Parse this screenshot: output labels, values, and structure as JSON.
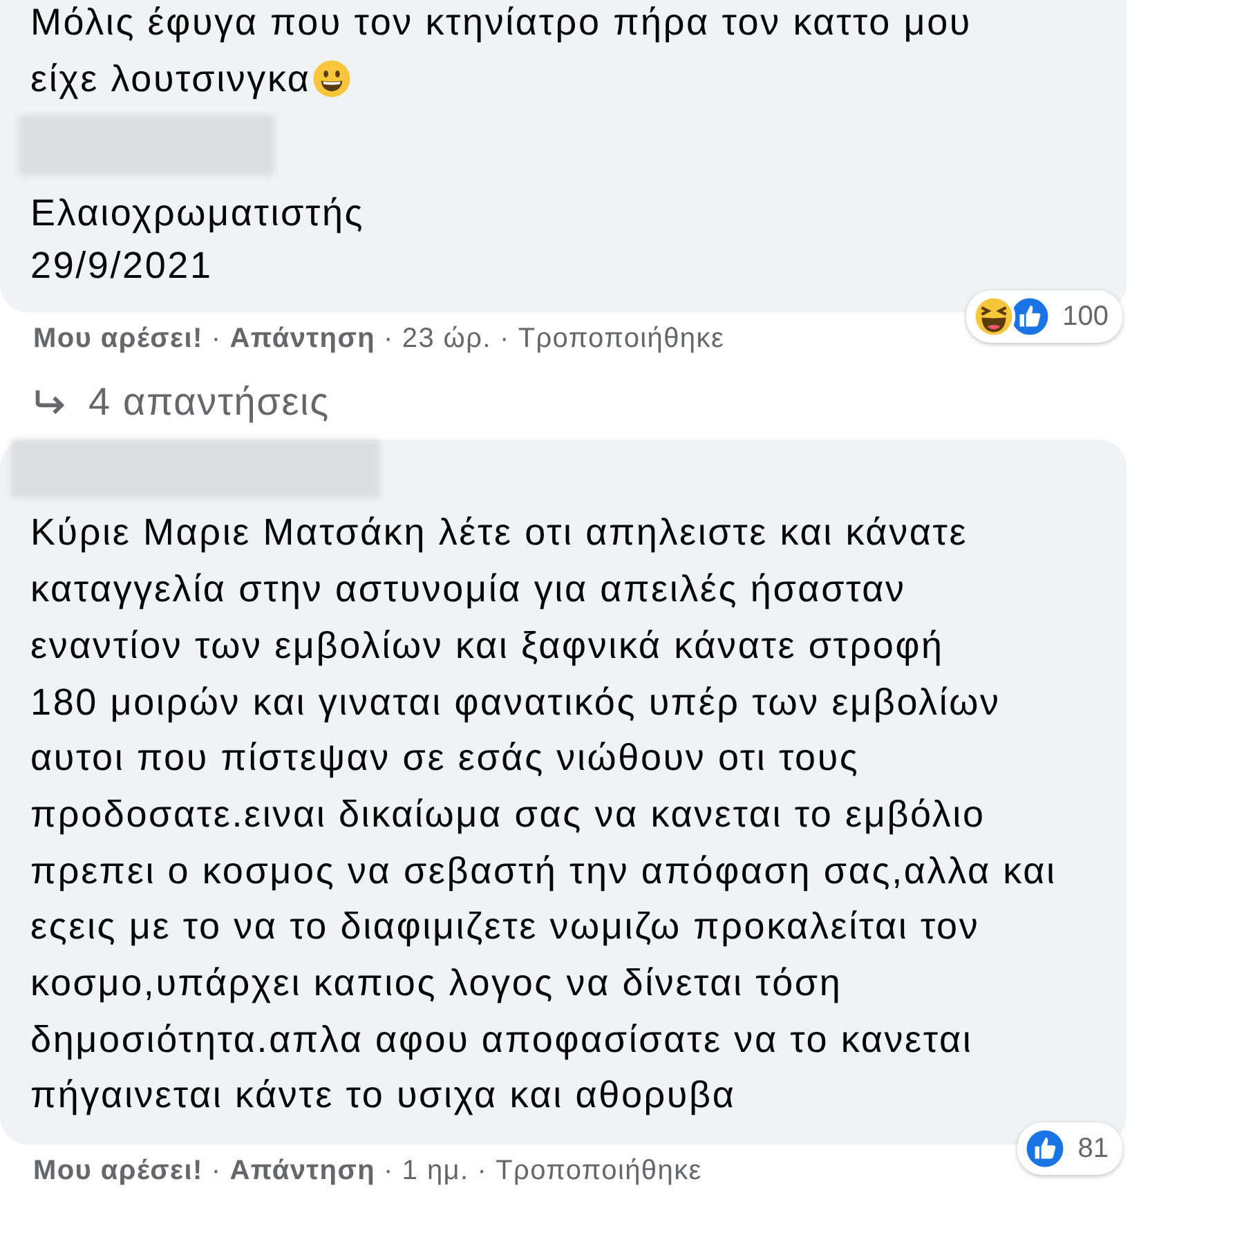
{
  "comments": [
    {
      "text_lines": [
        "Μόλις έφυγα που τον κτηνίατρο πήρα τον καττο μου",
        "είχε λουτσινγκα"
      ],
      "text_emoji": {
        "kind": "grinning"
      },
      "top_cut": true,
      "signature": [
        "Ελαιοχρωματιστής",
        "29/9/2021"
      ],
      "reactions": [
        {
          "kind": "haha"
        },
        {
          "kind": "like"
        }
      ],
      "reaction_count": "100",
      "like_label": "Μου αρέσει!",
      "reply_label": "Απάντηση",
      "separator": "·",
      "time": "23 ώρ.",
      "edited": "Τροποποιήθηκε",
      "replies_link": "4 απαντήσεις"
    },
    {
      "text_lines": [
        "Κύριε Μαριε Ματσάκη λέτε οτι απηλειστε και κάνατε",
        "καταγγελία στην αστυνομία για απειλές ήσασταν",
        "εναντίον των εμβολίων και ξαφνικά κάνατε στροφή",
        "180 μοιρών και γιναται φανατικός υπέρ των εμβολίων",
        "αυτοι που πίστεψαν σε εσάς νιώθουν οτι τους",
        "προδοσατε.ειναι δικαίωμα σας να κανεται το εμβόλιο",
        "πρεπει ο κοσμος να σεβαστή την απόφαση σας,αλλα και",
        "εςεις με το να το διαφιμιζετε νωμιζω προκαλείται τον",
        "κοσμο,υπάρχει καπιος λογος να δίνεται τόση",
        "δημοσιότητα.απλα αφου αποφασίσατε να το κανεται",
        "πήγαινεται κάντε το υσιχα και αθορυβα"
      ],
      "top_cut": false,
      "reactions": [
        {
          "kind": "like"
        }
      ],
      "reaction_count": "81",
      "like_label": "Μου αρέσει!",
      "reply_label": "Απάντηση",
      "separator": "·",
      "time": "1 ημ.",
      "edited": "Τροποποιήθηκε"
    }
  ]
}
